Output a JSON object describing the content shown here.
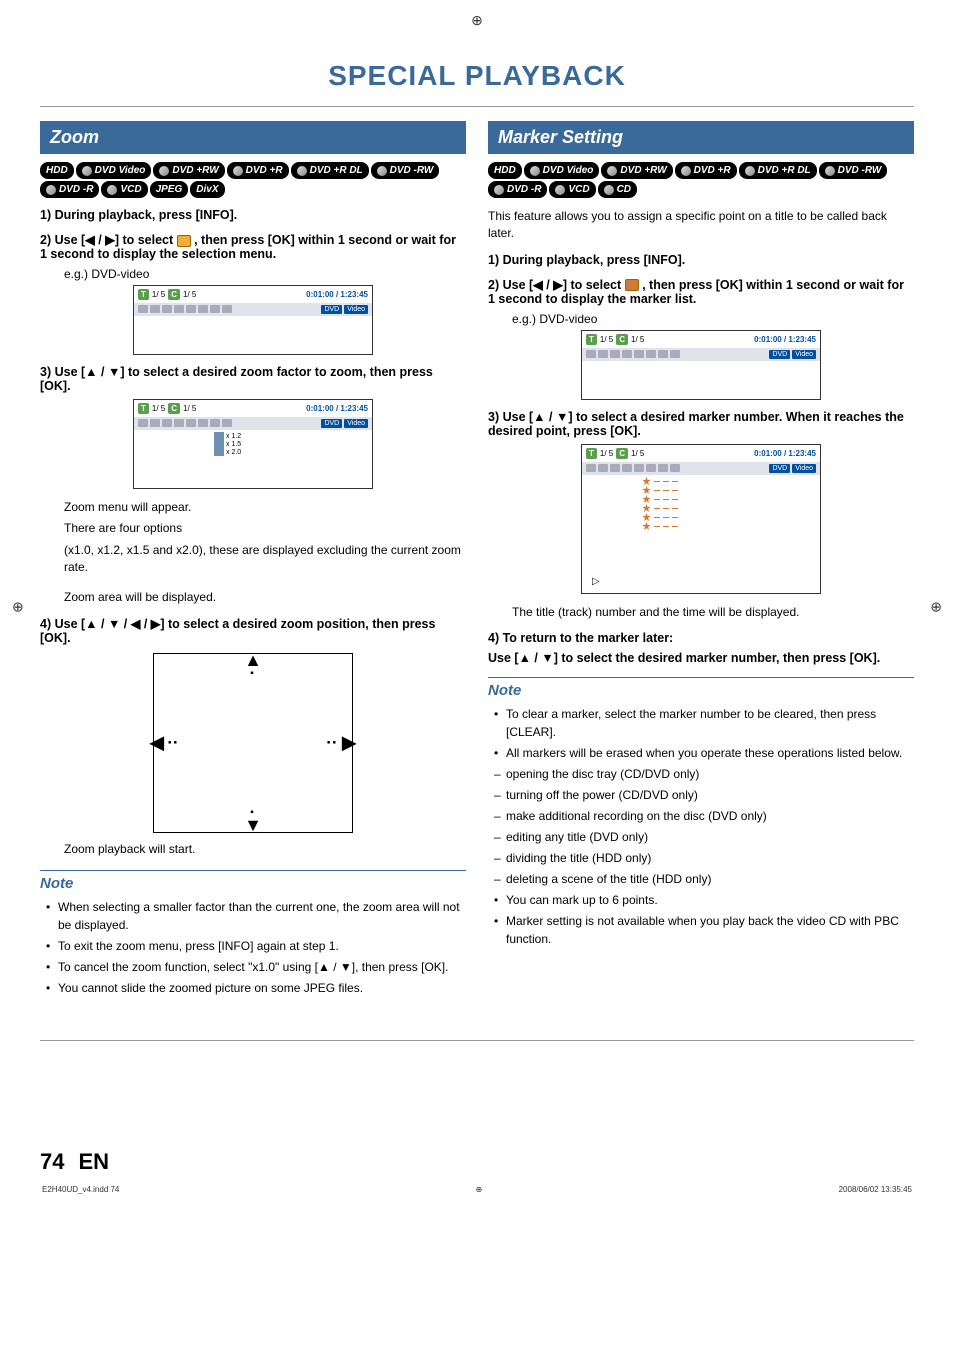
{
  "page": {
    "title": "SPECIAL PLAYBACK",
    "page_number": "74",
    "lang": "EN",
    "footer_file": "E2H40UD_v4.indd   74",
    "footer_date": "2008/06/02   13:35:45"
  },
  "zoom": {
    "heading": "Zoom",
    "badges": [
      "HDD",
      "DVD Video",
      "DVD +RW",
      "DVD +R",
      "DVD +R DL",
      "DVD -RW",
      "DVD -R",
      "VCD",
      "JPEG",
      "DivX"
    ],
    "step1": "1) During playback, press [INFO].",
    "step2_pre": "2) Use [",
    "step2_mid": "] to select ",
    "step2_post": " , then press [OK] within 1 second or wait for 1 second to display the selection menu.",
    "eg": "e.g.) DVD-video",
    "osd1": {
      "t": "T",
      "tval": "1/  5",
      "c": "C",
      "cval": "1/  5",
      "time": "0:01:00 / 1:23:45",
      "dvd": "DVD",
      "video": "Video"
    },
    "step3": "3) Use [▲ / ▼] to select a desired zoom factor to zoom, then press [OK].",
    "osd2": {
      "t": "T",
      "tval": "1/  5",
      "c": "C",
      "cval": "1/  5",
      "time": "0:01:00 / 1:23:45",
      "dvd": "DVD",
      "video": "Video",
      "opts": [
        "x 1.2",
        "x 1.5",
        "x 2.0"
      ]
    },
    "desc1": "Zoom menu will appear.",
    "desc2": "There are four options",
    "desc3": "(x1.0, x1.2, x1.5 and x2.0), these are displayed excluding the current zoom rate.",
    "desc4": "Zoom area will be displayed.",
    "step4": "4) Use [▲ / ▼ / ◀ / ▶] to select a desired zoom position, then press [OK].",
    "desc5": "Zoom playback will start.",
    "note_header": "Note",
    "notes": [
      "When selecting a smaller factor than the current one, the zoom area will not be displayed.",
      "To exit the zoom menu, press [INFO] again at step 1.",
      "To cancel the zoom function, select \"x1.0\" using [▲ / ▼], then press [OK].",
      "You cannot slide the zoomed picture on some JPEG files."
    ]
  },
  "marker": {
    "heading": "Marker Setting",
    "badges": [
      "HDD",
      "DVD Video",
      "DVD +RW",
      "DVD +R",
      "DVD +R DL",
      "DVD -RW",
      "DVD -R",
      "VCD",
      "CD"
    ],
    "intro": "This feature allows you to assign a specific point on a title to be called back later.",
    "step1": "1) During playback, press [INFO].",
    "step2_pre": "2) Use [",
    "step2_mid": "] to select ",
    "step2_post": " , then press [OK] within 1 second or wait for 1 second to display the marker list.",
    "eg": "e.g.) DVD-video",
    "osd1": {
      "t": "T",
      "tval": "1/  5",
      "c": "C",
      "cval": "1/  5",
      "time": "0:01:00 / 1:23:45",
      "dvd": "DVD",
      "video": "Video"
    },
    "step3": "3) Use [▲ / ▼] to select a desired marker number. When it reaches the desired point, press [OK].",
    "osd2": {
      "t": "T",
      "tval": "1/  5",
      "c": "C",
      "cval": "1/  5",
      "time": "0:01:00 / 1:23:45",
      "dvd": "DVD",
      "video": "Video",
      "rows": 6
    },
    "desc1": "The title (track) number and the time will be displayed.",
    "step4_a": "4) To return to the marker later:",
    "step4_b": "Use [▲ / ▼] to select the desired marker number, then press [OK].",
    "note_header": "Note",
    "notes_bullets1": [
      "To clear a marker, select the marker number to be cleared, then press [CLEAR].",
      "All markers will be erased when you operate these operations listed below."
    ],
    "notes_dashes": [
      "opening the disc tray (CD/DVD only)",
      "turning off the power (CD/DVD only)",
      "make additional recording on the disc (DVD only)",
      "editing any title (DVD only)",
      "dividing the title (HDD only)",
      "deleting a scene of the title (HDD only)"
    ],
    "notes_bullets2": [
      "You can mark up to 6 points.",
      "Marker setting is not available when you play back the video CD with PBC function."
    ]
  }
}
